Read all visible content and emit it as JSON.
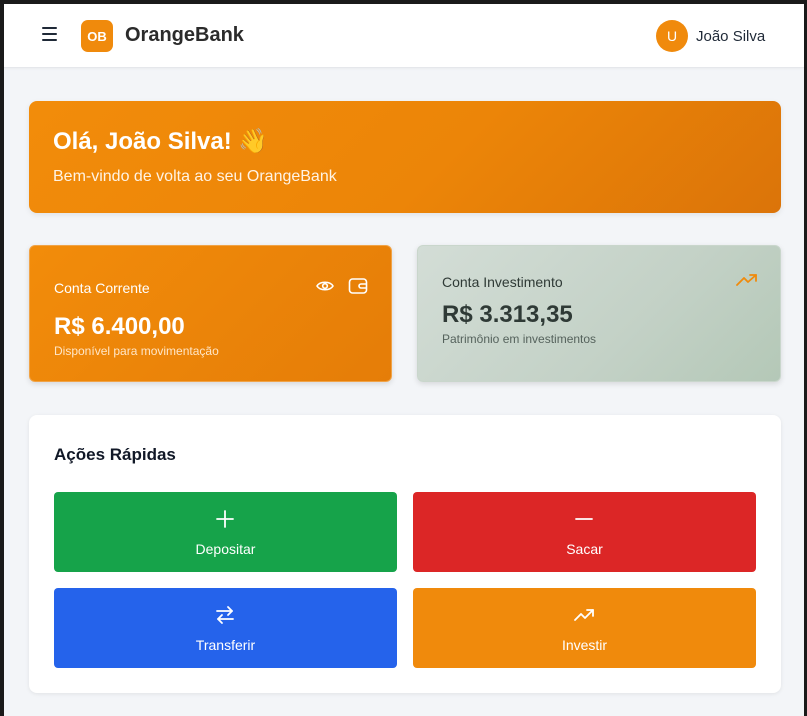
{
  "header": {
    "logo_text": "OB",
    "brand": "OrangeBank",
    "avatar_initial": "U",
    "user_name": "João Silva"
  },
  "welcome": {
    "title": "Olá, João Silva! 👋",
    "subtitle": "Bem-vindo de volta ao seu OrangeBank"
  },
  "accounts": {
    "checking": {
      "label": "Conta Corrente",
      "amount": "R$ 6.400,00",
      "caption": "Disponível para movimentação"
    },
    "investment": {
      "label": "Conta Investimento",
      "amount": "R$ 3.313,35",
      "caption": "Patrimônio em investimentos"
    }
  },
  "quick_actions": {
    "title": "Ações Rápidas",
    "deposit": "Depositar",
    "withdraw": "Sacar",
    "transfer": "Transferir",
    "invest": "Investir"
  },
  "colors": {
    "brand_orange": "#f08a0c",
    "deposit": "#16a34a",
    "withdraw": "#dc2626",
    "transfer": "#2563eb",
    "invest": "#f08a0c"
  },
  "icons": [
    "menu-icon",
    "eye-icon",
    "wallet-icon",
    "trend-up-icon",
    "plus-icon",
    "minus-icon",
    "transfer-icon"
  ]
}
